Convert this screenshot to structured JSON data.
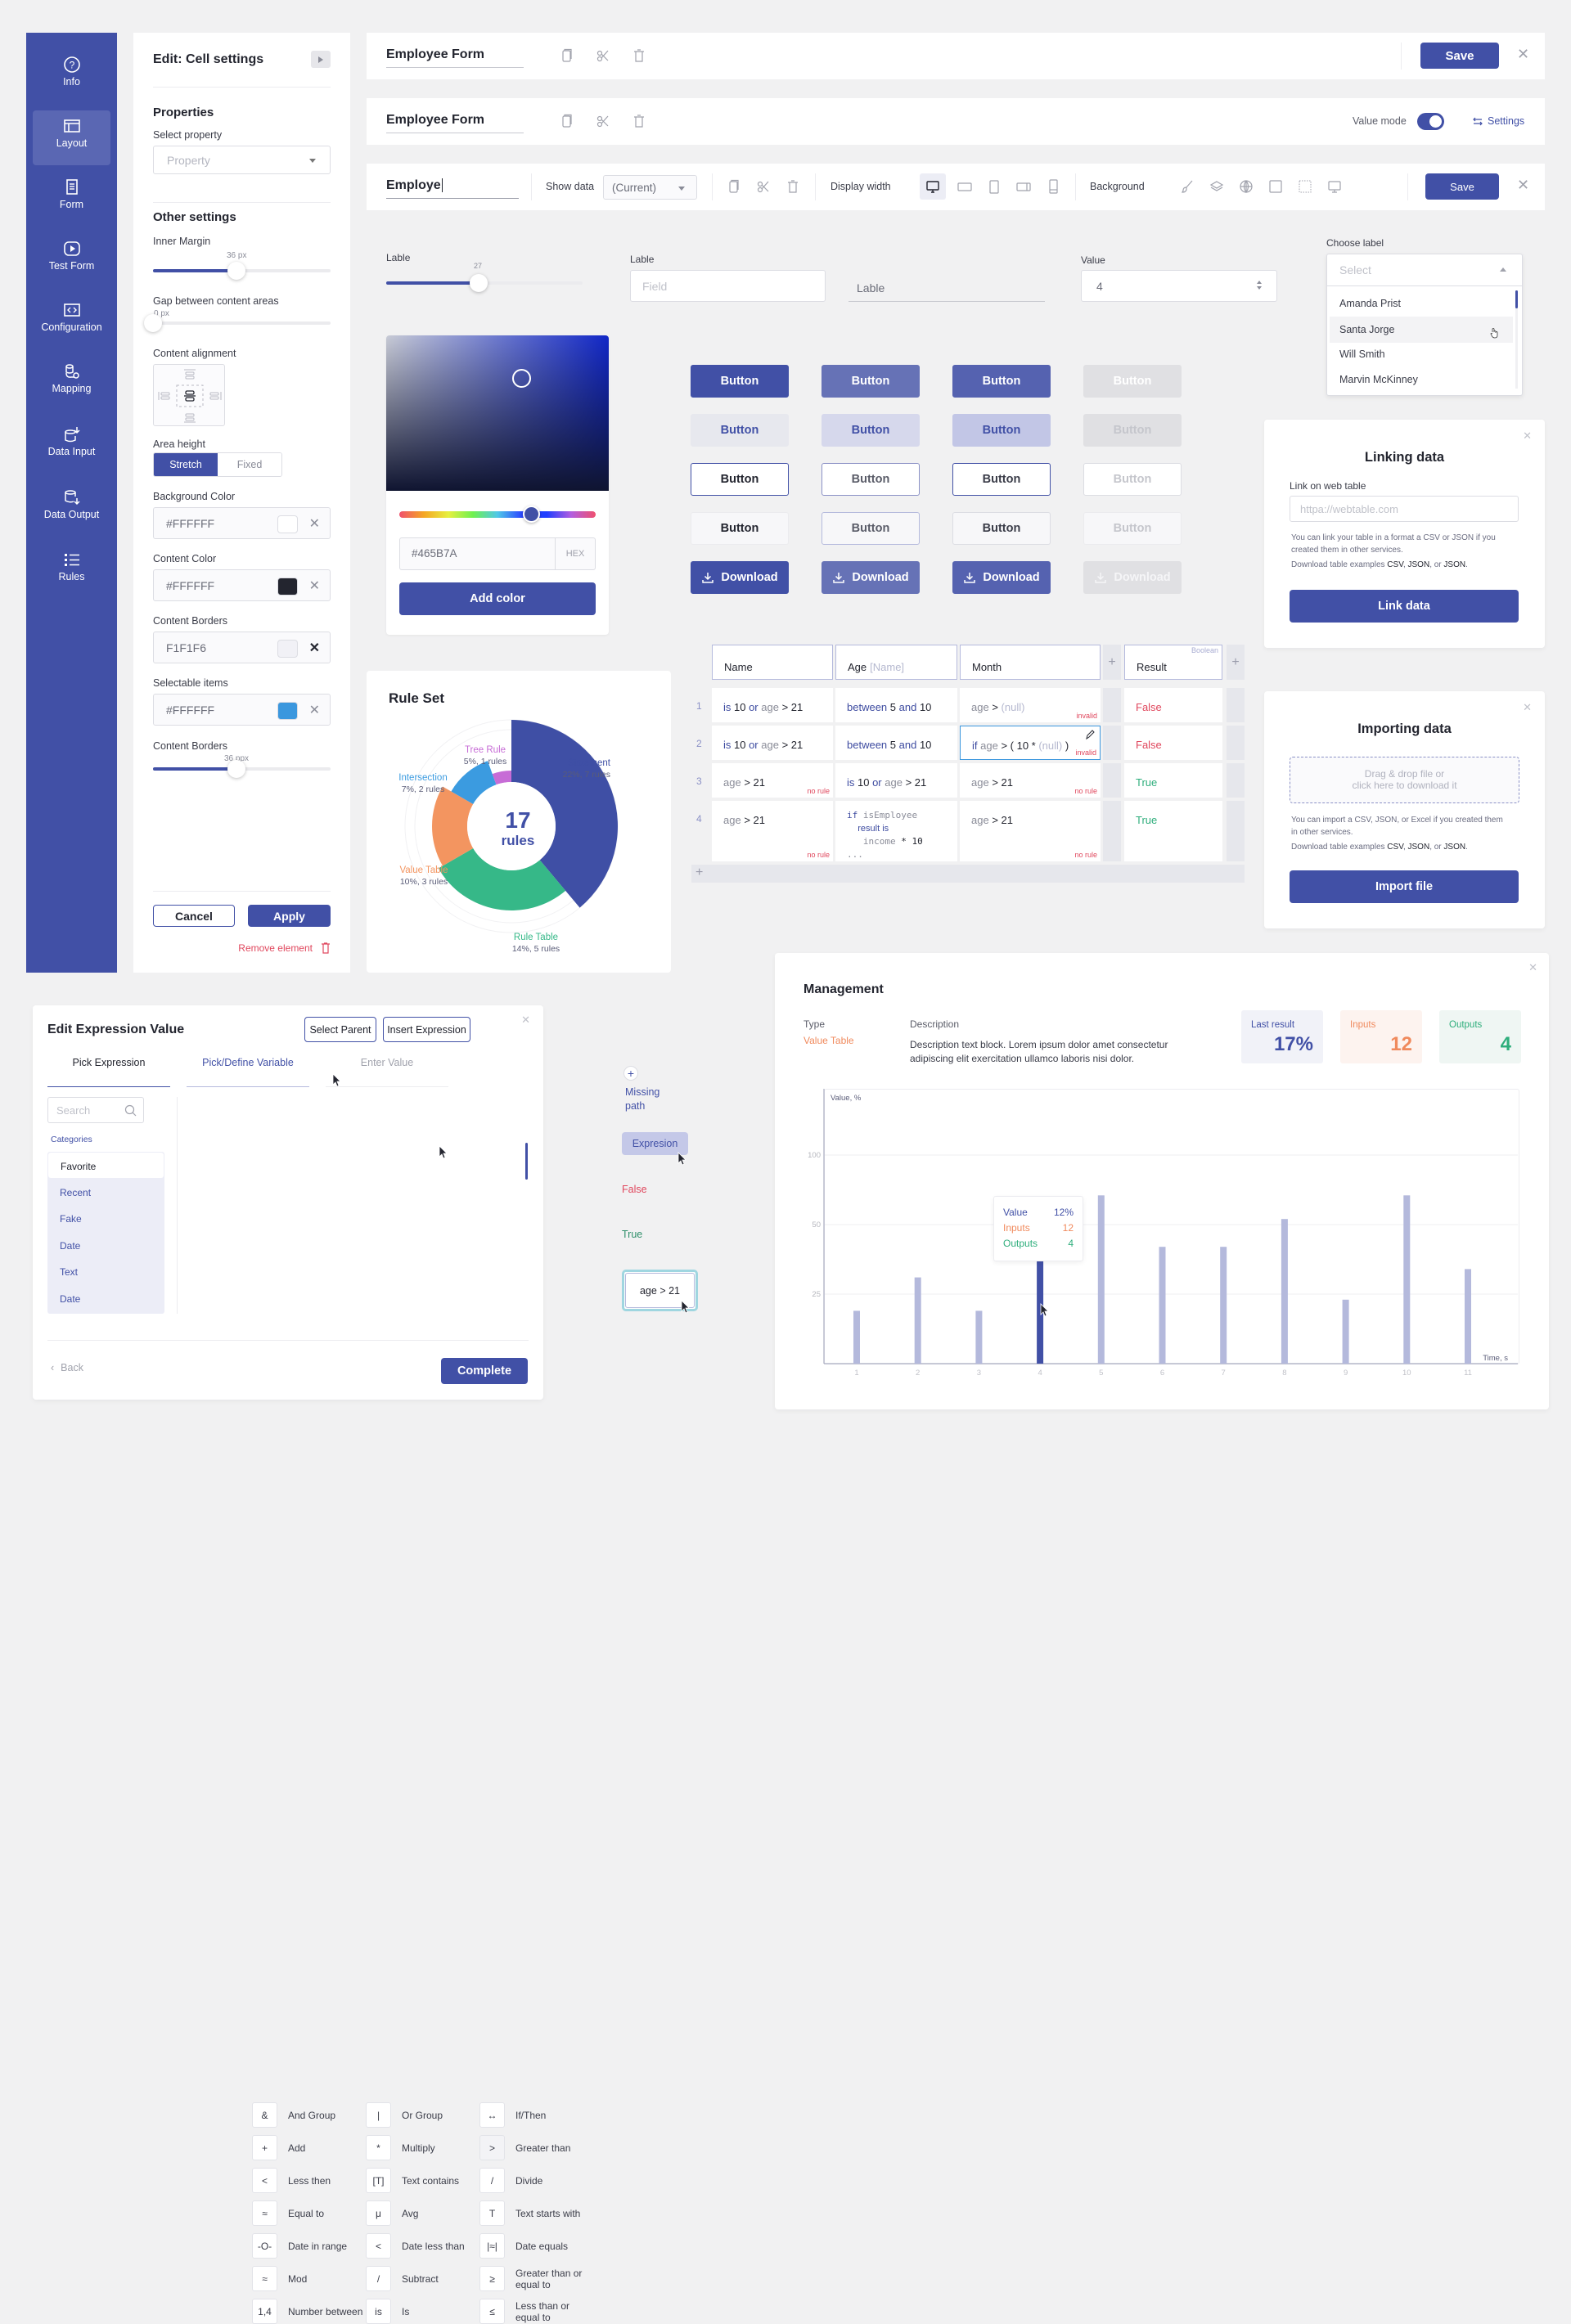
{
  "sidebar": {
    "items": [
      {
        "label": "Info",
        "icon": "question-circle-icon"
      },
      {
        "label": "Layout",
        "icon": "layout-icon",
        "active": true
      },
      {
        "label": "Form",
        "icon": "form-icon"
      },
      {
        "label": "Test Form",
        "icon": "play-icon"
      },
      {
        "label": "Configuration",
        "icon": "code-icon"
      },
      {
        "label": "Mapping",
        "icon": "mapping-icon"
      },
      {
        "label": "Data Input",
        "icon": "data-input-icon"
      },
      {
        "label": "Data Output",
        "icon": "data-output-icon"
      },
      {
        "label": "Rules",
        "icon": "rules-icon"
      }
    ]
  },
  "cell_settings": {
    "title": "Edit: Cell settings",
    "properties_heading": "Properties",
    "select_property_label": "Select property",
    "property_placeholder": "Property",
    "other_settings_heading": "Other settings",
    "inner_margin_label": "Inner Margin",
    "inner_margin_value": "36 px",
    "inner_margin_fraction": 0.47,
    "gap_label": "Gap between content areas",
    "gap_value": "0 px",
    "gap_fraction": 0,
    "content_alignment_label": "Content alignment",
    "content_alignment_selected": "center",
    "area_height_label": "Area height",
    "area_height_options": [
      "Stretch",
      "Fixed"
    ],
    "area_height_selected": "Stretch",
    "background_color_label": "Background Color",
    "background_color_value": "#FFFFFF",
    "background_color_swatch": "#FFFFFF",
    "content_color_label": "Content Color",
    "content_color_value": "#FFFFFF",
    "content_color_swatch": "#23252F",
    "content_borders_label": "Content Borders",
    "content_borders_value": "F1F1F6",
    "content_borders_swatch": "#F1F1F6",
    "selectable_items_label": "Selectable items",
    "selectable_items_value": "#FFFFFF",
    "selectable_items_swatch": "#3B97DE",
    "content_borders2_label": "Content Borders",
    "content_borders2_value": "36 ppx",
    "content_borders2_fraction": 0.47,
    "cancel_label": "Cancel",
    "apply_label": "Apply",
    "remove_label": "Remove element"
  },
  "header1": {
    "title": "Employee Form",
    "save_label": "Save"
  },
  "header2": {
    "title": "Employee Form",
    "value_mode_label": "Value mode",
    "value_mode_on": true,
    "settings_label": "Settings"
  },
  "header3": {
    "title": "Employe",
    "show_data_label": "Show data",
    "show_data_value": "(Current)",
    "display_width_label": "Display width",
    "background_label": "Background",
    "save_label": "Save"
  },
  "controls": {
    "slider_label": "Lable",
    "slider_value": "27",
    "slider_fraction": 0.47,
    "field_label": "Lable",
    "field_placeholder": "Field",
    "underline_field_placeholder": "Lable",
    "value_label": "Value",
    "value_number": "4",
    "choose_label": "Choose label",
    "select_placeholder": "Select",
    "options": [
      "Amanda Prist",
      "Santa Jorge",
      "Will Smith",
      "Marvin McKinney"
    ],
    "hovered_option": "Santa Jorge"
  },
  "color_picker": {
    "hex_value": "#465B7A",
    "hex_unit": "HEX",
    "add_label": "Add color",
    "hue_fraction": 0.67
  },
  "button_grid": {
    "label": "Button",
    "download_label": "Download"
  },
  "rule_set": {
    "title": "Rule Set",
    "center_number": "17",
    "center_label": "rules"
  },
  "chart_data": [
    {
      "type": "pie",
      "title": "Rule Set",
      "center_text": "17 rules",
      "segments": [
        {
          "name": "Statement",
          "percent": 22,
          "rules": 7,
          "label": "22%, 7 rules",
          "color": "#3f4fa5"
        },
        {
          "name": "Rule Table",
          "percent": 14,
          "rules": 5,
          "label": "14%, 5 rules",
          "color": "#36b888"
        },
        {
          "name": "Value Table",
          "percent": 10,
          "rules": 3,
          "label": "10%, 3 rules",
          "color": "#f39560"
        },
        {
          "name": "Intersection",
          "percent": 7,
          "rules": 2,
          "label": "7%, 2 rules",
          "color": "#3b9be0"
        },
        {
          "name": "Tree Rule",
          "percent": 5,
          "rules": 1,
          "label": "5%, 1 rules",
          "color": "#c76cd6"
        }
      ]
    },
    {
      "type": "bar",
      "title": "",
      "xlabel": "Time, s",
      "ylabel": "Value, %",
      "categories": [
        "1",
        "2",
        "3",
        "4",
        "5",
        "6",
        "7",
        "8",
        "9",
        "10",
        "11"
      ],
      "values": [
        19,
        31,
        19,
        38,
        71,
        42,
        42,
        54,
        23,
        71,
        34
      ],
      "highlighted_index": 3,
      "y_ticks": [
        25,
        50,
        100
      ],
      "ylim": [
        0,
        100
      ],
      "grid": true,
      "tooltip": {
        "Value": "12%",
        "Inputs": "12",
        "Outputs": "4"
      }
    }
  ],
  "decision_table": {
    "columns": [
      {
        "name": "Name",
        "hint": ""
      },
      {
        "name": "Age",
        "hint": "[Name]"
      },
      {
        "name": "Month",
        "hint": ""
      },
      {
        "name": "Result",
        "hint": "Boolean"
      }
    ],
    "rows": [
      {
        "num": "1",
        "name": "is 10 or age > 21",
        "age": "between 5 and 10",
        "month": "age > (null)",
        "month_flag": "invalid",
        "name_flag": "",
        "result": "False"
      },
      {
        "num": "2",
        "name": "is 10 or age > 21",
        "age": "between 5 and 10",
        "month": "if age > ( 10 * (null) )",
        "month_flag": "invalid",
        "name_flag": "",
        "result": "False"
      },
      {
        "num": "3",
        "name": "age > 21",
        "age": "is 10 or age > 21",
        "month": "age > 21",
        "month_flag": "no rule",
        "name_flag": "no rule",
        "result": "True"
      },
      {
        "num": "4",
        "name": "age > 21",
        "age": "if isEmployee result is income * 10 ...",
        "month": "age > 21",
        "month_flag": "no rule",
        "name_flag": "no rule",
        "result": "True"
      }
    ]
  },
  "linking": {
    "title": "Linking data",
    "field_label": "Link on web table",
    "placeholder": "httpa://webtable.com",
    "note1": "You can link your table in a format a CSV or JSON if you created them in other services.",
    "note2_prefix": "Download table examples",
    "links": [
      "CSV",
      "JSON",
      "JSON"
    ],
    "button_label": "Link data"
  },
  "importing": {
    "title": "Importing data",
    "drop_text_1": "Drag & drop file or",
    "drop_text_2": "click here to download it",
    "note1": "You can import a CSV, JSON, or Excel if you created them in other services.",
    "note2_prefix": "Download table examples",
    "links": [
      "CSV",
      "JSON",
      "JSON"
    ],
    "button_label": "Import file"
  },
  "expression": {
    "title": "Edit Expression Value",
    "select_parent_label": "Select Parent",
    "insert_expression_label": "Insert Expression",
    "tabs": [
      "Pick Expression",
      "Pick/Define Variable",
      "Enter Value"
    ],
    "active_tab": "Pick Expression",
    "search_placeholder": "Search",
    "categories_label": "Categories",
    "categories": [
      "Favorite",
      "Recent",
      "Fake",
      "Date",
      "Text",
      "Date"
    ],
    "selected_category": "Favorite",
    "operators": [
      {
        "symbol": "&",
        "label": "And Group"
      },
      {
        "symbol": "|",
        "label": "Or Group"
      },
      {
        "symbol": "↔",
        "label": "If/Then"
      },
      {
        "symbol": "+",
        "label": "Add"
      },
      {
        "symbol": "*",
        "label": "Multiply"
      },
      {
        "symbol": ">",
        "label": "Greater than"
      },
      {
        "symbol": "<",
        "label": "Less then"
      },
      {
        "symbol": "[T]",
        "label": "Text contains"
      },
      {
        "symbol": "/",
        "label": "Divide"
      },
      {
        "symbol": "≈",
        "label": "Equal to"
      },
      {
        "symbol": "μ",
        "label": "Avg"
      },
      {
        "symbol": "T",
        "label": "Text starts with"
      },
      {
        "symbol": "-O-",
        "label": "Date in range"
      },
      {
        "symbol": "<",
        "label": "Date less than"
      },
      {
        "symbol": "|≈|",
        "label": "Date equals"
      },
      {
        "symbol": "≈",
        "label": "Mod"
      },
      {
        "symbol": "/",
        "label": "Subtract"
      },
      {
        "symbol": "≥",
        "label": "Greater than or equal to"
      },
      {
        "symbol": "1,4",
        "label": "Number between"
      },
      {
        "symbol": "is",
        "label": "Is"
      },
      {
        "symbol": "≤",
        "label": "Less than or equal to"
      }
    ],
    "back_label": "Back",
    "complete_label": "Complete"
  },
  "states": {
    "missing_path_label": "Missing path",
    "expression_chip": "Expresion",
    "false_label": "False",
    "true_label": "True",
    "expression_box": "age > 21"
  },
  "management": {
    "title": "Management",
    "type_label": "Type",
    "type_value": "Value Table",
    "description_label": "Description",
    "description": "Description text block. Lorem ipsum dolor amet consectetur adipiscing elit exercitation ullamco laboris nisi dolor.",
    "stats": [
      {
        "label": "Last result",
        "value": "17%",
        "color": "#4150a6",
        "bg": "#f1f2f8"
      },
      {
        "label": "Inputs",
        "value": "12",
        "color": "#f08a5d",
        "bg": "#fdf3ef"
      },
      {
        "label": "Outputs",
        "value": "4",
        "color": "#2fae7c",
        "bg": "#eff6f3"
      }
    ]
  },
  "colors": {
    "primary": "#4150A6",
    "danger": "#E0475D",
    "success": "#2FAE7C",
    "orange": "#F08A5D"
  }
}
